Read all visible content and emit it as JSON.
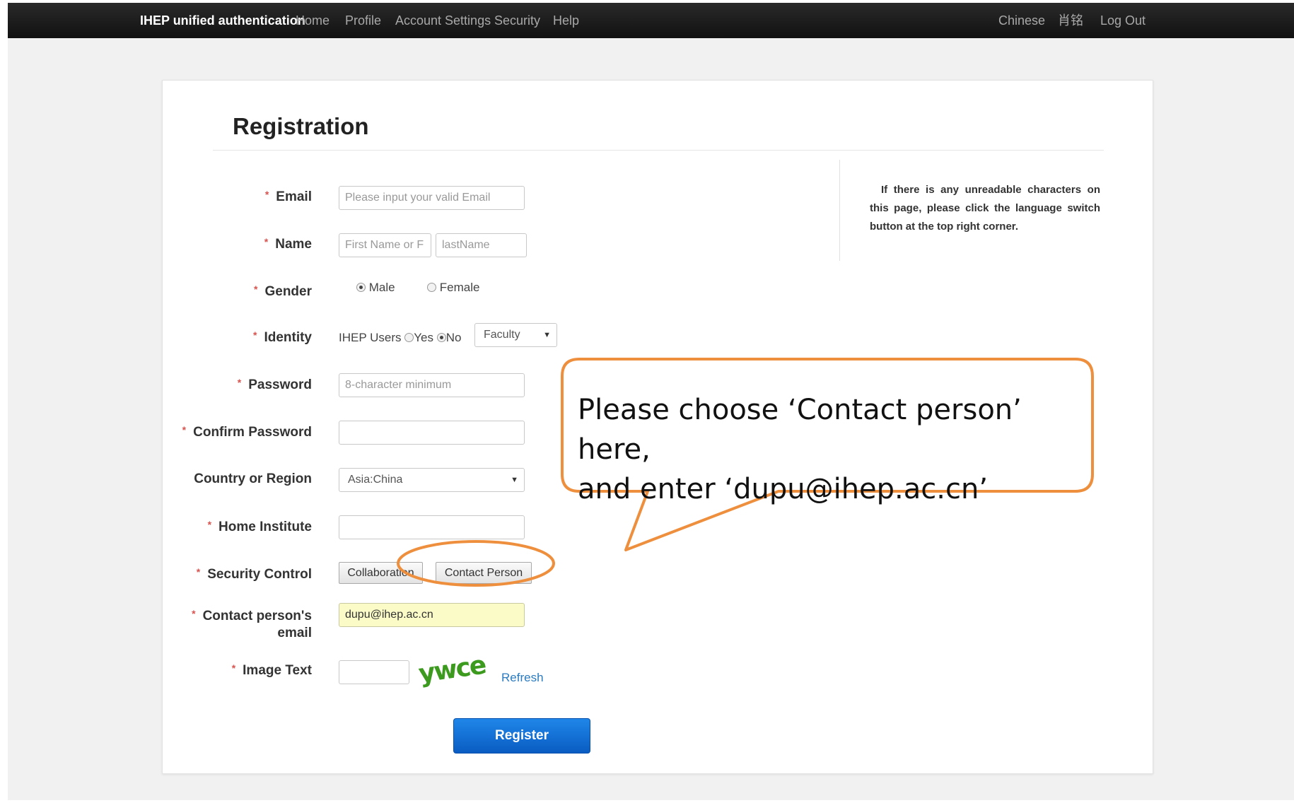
{
  "navbar": {
    "brand": "IHEP unified authentication",
    "left_items": [
      "Home",
      "Profile",
      "Account Settings",
      "Security",
      "Help"
    ],
    "right_items": [
      "Chinese",
      "肖铭",
      "Log Out"
    ]
  },
  "page": {
    "title": "Registration",
    "notice": "If there is any unreadable characters on this page, please click the language switch button at the top right corner."
  },
  "form": {
    "required_mark": "*",
    "email": {
      "label": "Email",
      "placeholder": "Please input your valid Email",
      "value": ""
    },
    "name": {
      "label": "Name",
      "first_placeholder": "First Name or F",
      "last_placeholder": "lastName"
    },
    "gender": {
      "label": "Gender",
      "options": [
        "Male",
        "Female"
      ],
      "selected": "Male"
    },
    "identity": {
      "label": "Identity",
      "ihep_users_label": "IHEP Users",
      "yes": "Yes",
      "no": "No",
      "selected": "No",
      "type_value": "Faculty"
    },
    "password": {
      "label": "Password",
      "placeholder": "8-character minimum"
    },
    "confirm_password": {
      "label": "Confirm Password"
    },
    "country": {
      "label": "Country or Region",
      "value": "Asia:China"
    },
    "home_institute": {
      "label": "Home Institute"
    },
    "security_control": {
      "label": "Security Control",
      "buttons": [
        "Collaboration",
        "Contact Person"
      ]
    },
    "contact_email": {
      "label_line1": "Contact person's",
      "label_line2": "email",
      "value": "dupu@ihep.ac.cn"
    },
    "image_text": {
      "label": "Image Text",
      "captcha": "ywce",
      "refresh": "Refresh"
    },
    "register_label": "Register"
  },
  "annotation": {
    "text_line1": "Please choose ‘Contact person’ here,",
    "text_line2": "and enter ‘dupu@ihep.ac.cn’",
    "color": "#ee8f3e"
  },
  "colors": {
    "navbar_bg": "#1b1b1b",
    "register_button": "#0a6ad6",
    "required": "#d9534f",
    "highlighted_input": "#fbfbc8"
  }
}
